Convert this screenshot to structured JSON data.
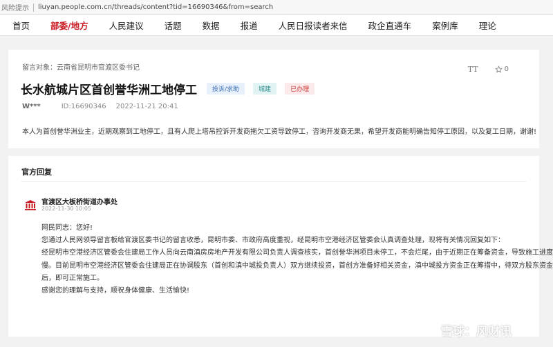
{
  "browser": {
    "warning": "风险提示",
    "url": "liuyan.people.com.cn/threads/content?tid=16690346&from=search"
  },
  "nav": {
    "items": [
      {
        "label": "首页",
        "active": false
      },
      {
        "label": "部委/地方",
        "active": true
      },
      {
        "label": "人民建议",
        "active": false
      },
      {
        "label": "话题",
        "active": false
      },
      {
        "label": "数据",
        "active": false
      },
      {
        "label": "报道",
        "active": false
      },
      {
        "label": "人民日报读者来信",
        "active": false
      },
      {
        "label": "政企直通车",
        "active": false
      },
      {
        "label": "案例库",
        "active": false
      },
      {
        "label": "理论",
        "active": false
      }
    ]
  },
  "post": {
    "target": "留言对象：云南省昆明市官渡区委书记",
    "font_tool": "TT",
    "star_count": "0",
    "title": "长水航城片区首创誉华洲工地停工",
    "tags": [
      {
        "label": "投诉/求助",
        "color": "#3a6fb5"
      },
      {
        "label": "城建",
        "color": "#2a8c8c"
      },
      {
        "label": "已办理",
        "color": "#d23a3a"
      }
    ],
    "user": "W***",
    "id": "ID:16690346",
    "time": "2022-11-21 20:41",
    "content": "本人为首创誉华洲业主，近期观察到工地停工，且有人爬上塔吊控诉开发商拖欠工资导致停工，咨询开发商无果，希望开发商能明确告知停工原因，以及复工日期，谢谢!"
  },
  "reply": {
    "section_title": "官方回复",
    "org": "官渡区大板桥街道办事处",
    "time": "2022-11-30 10:05",
    "lines": [
      "网民同志：您好!",
      "您通过人民网领导留言板给官渡区委书记的留言收悉，昆明市委、市政府高度重视，经昆明市空港经济区管委会认真调查处理，现将有关情况回复如下：",
      "经昆明市空港经济区管委会住建局工作人员向云南滇房房地产开发有限公司负责人调查核实，首创誉华洲项目未停工，不会烂尾，由于近期正在筹备资金，导致施工进度缓",
      "慢。目前昆明市空港经济区管委会住建局正在协调股东（首创和滇中城投负责人）双方继续投资，首创方准备好相关资金，滇中城投方资金正在筹措中，待双方股东资金到位",
      "后，即可正常施工。",
      "感谢您的理解与支持，顺祝身体健康、生活愉快!"
    ]
  },
  "watermark": {
    "text": "雪球：风财讯"
  },
  "colors": {
    "accent_red": "#c8161d"
  }
}
